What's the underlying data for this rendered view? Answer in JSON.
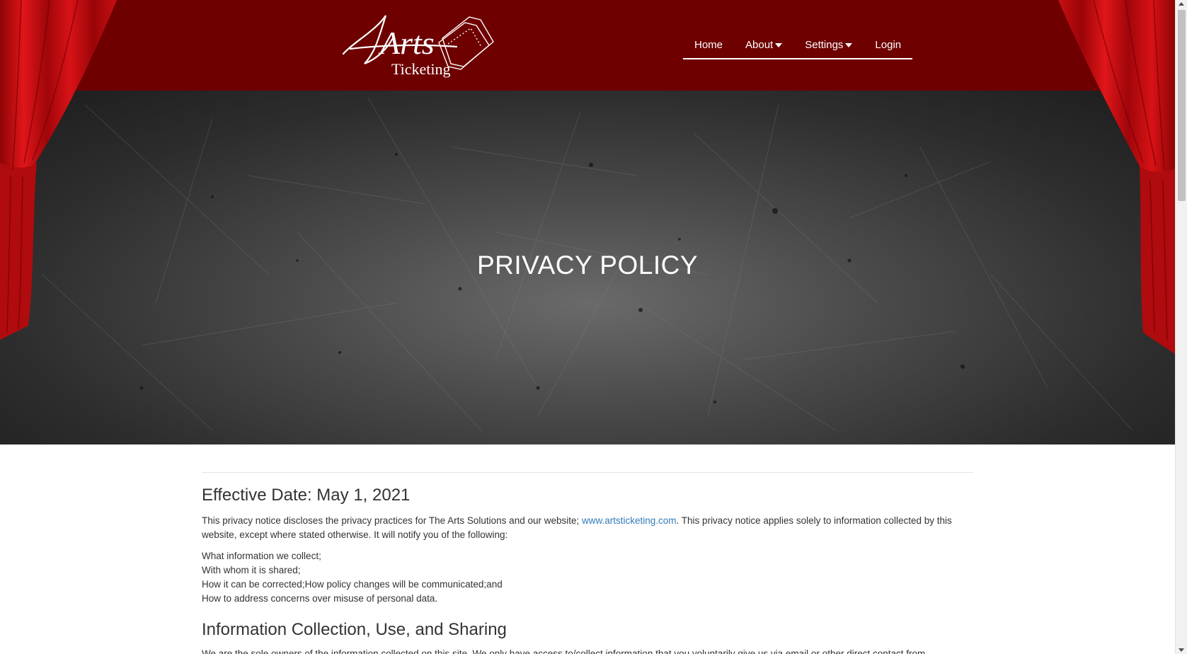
{
  "brand": {
    "logo_script": "Arts",
    "logo_sub": "Ticketing",
    "colors": {
      "header_bg": "#6e0000",
      "curtain": "#c4090c",
      "link": "#337ab7"
    }
  },
  "nav": {
    "items": [
      {
        "label": "Home",
        "has_caret": false
      },
      {
        "label": "About",
        "has_caret": true
      },
      {
        "label": "Settings",
        "has_caret": true
      },
      {
        "label": "Login",
        "has_caret": false
      }
    ]
  },
  "hero": {
    "title": "PRIVACY POLICY"
  },
  "content": {
    "effective_date": "Effective Date: May 1, 2021",
    "intro_before_link": "This privacy notice discloses the privacy practices for The Arts Solutions and our website; ",
    "intro_link": "www.artsticketing.com",
    "intro_after_link": ". This privacy notice applies solely to information collected by this website, except where stated otherwise. It will notify you of the following:",
    "list": [
      "What information we collect;",
      "With whom it is shared;",
      "How it can be corrected;How policy changes will be communicated;and",
      "How to address concerns over misuse of personal data."
    ],
    "section_heading": "Information Collection, Use, and Sharing",
    "section_text": "We are the sole owners of the information collected on this site. We only have access to/collect information that you voluntarily give us via email or other direct contact from"
  }
}
